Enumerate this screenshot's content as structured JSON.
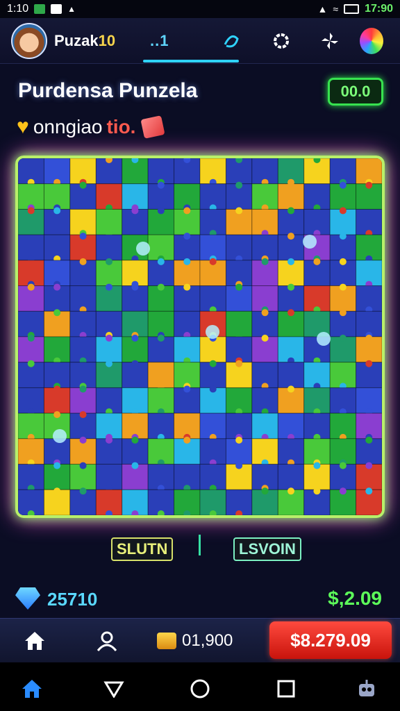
{
  "status": {
    "time_left": "1:10",
    "time_right": "17:90"
  },
  "header": {
    "app_name": "Puzak",
    "app_name_accent": "10",
    "signal_label": "..1"
  },
  "level": {
    "title": "Purdensa Punzela",
    "score": "00.0",
    "subtitle": "onngiao",
    "subtitle_accent": "tio."
  },
  "actions": {
    "solution": "SLUTN",
    "lesson": "LSVOIN"
  },
  "currency": {
    "gems": "25710",
    "coins": "$,2.09"
  },
  "bottombar": {
    "cost": "01,900",
    "buy_label": "$8.279.09"
  },
  "icons": [
    "cat-icon",
    "mail-icon",
    "bell-icon",
    "wifi-icon",
    "battery-icon",
    "compass-icon",
    "gear-icon",
    "fan-icon",
    "home-icon",
    "profile-icon",
    "back-icon",
    "circle-home-icon",
    "square-recent-icon",
    "bot-icon"
  ],
  "colors": {
    "accent": "#2fd3ff",
    "score_border": "#37e24f",
    "buy_button": "#e8261c",
    "board_glow": "#b8f06a"
  }
}
